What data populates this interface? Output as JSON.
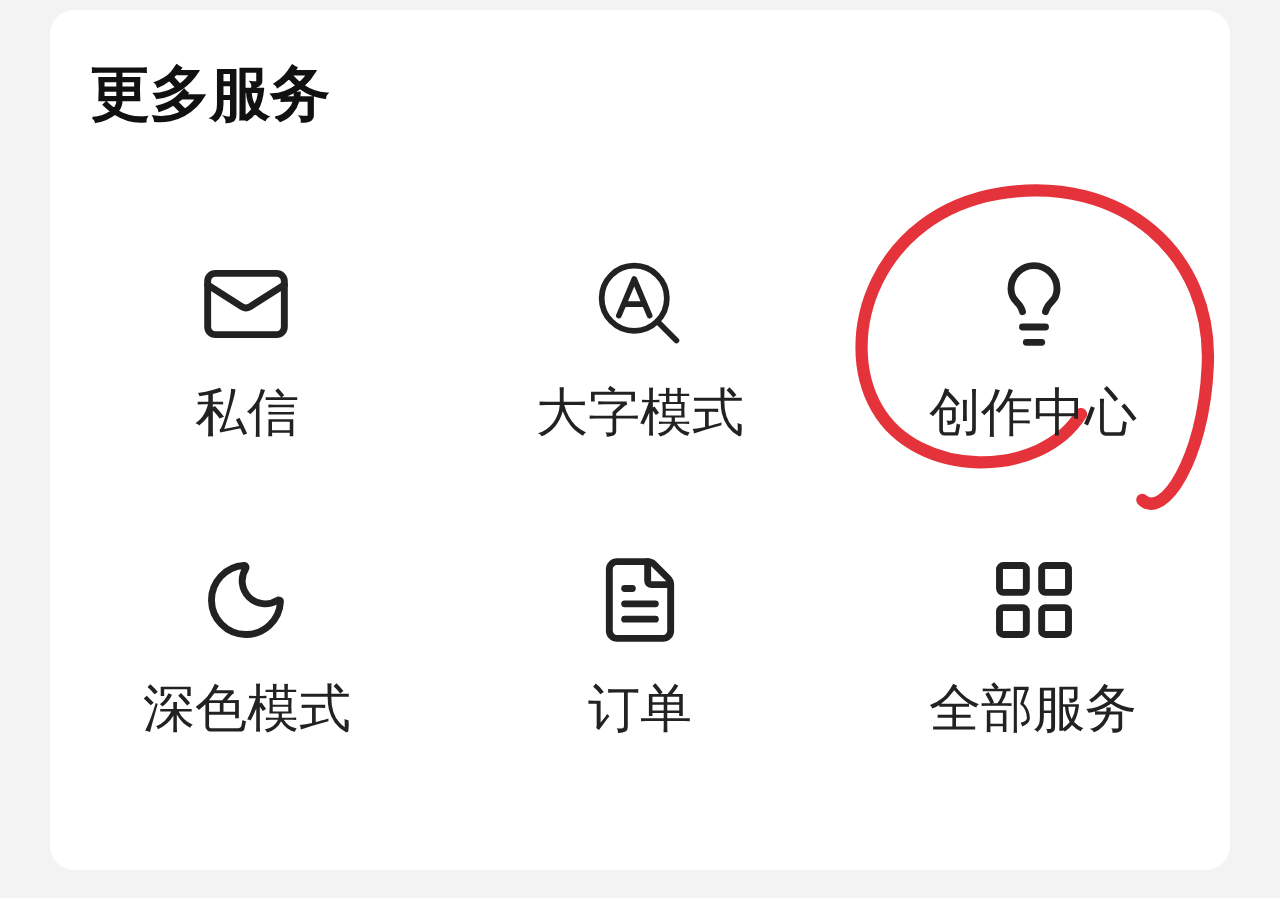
{
  "title": "更多服务",
  "items": [
    {
      "kind": "mail",
      "label": "私信",
      "circled": false
    },
    {
      "kind": "big-text",
      "label": "大字模式",
      "circled": false
    },
    {
      "kind": "bulb",
      "label": "创作中心",
      "circled": true
    },
    {
      "kind": "moon",
      "label": "深色模式",
      "circled": false
    },
    {
      "kind": "document",
      "label": "订单",
      "circled": false
    },
    {
      "kind": "grid",
      "label": "全部服务",
      "circled": false
    }
  ]
}
